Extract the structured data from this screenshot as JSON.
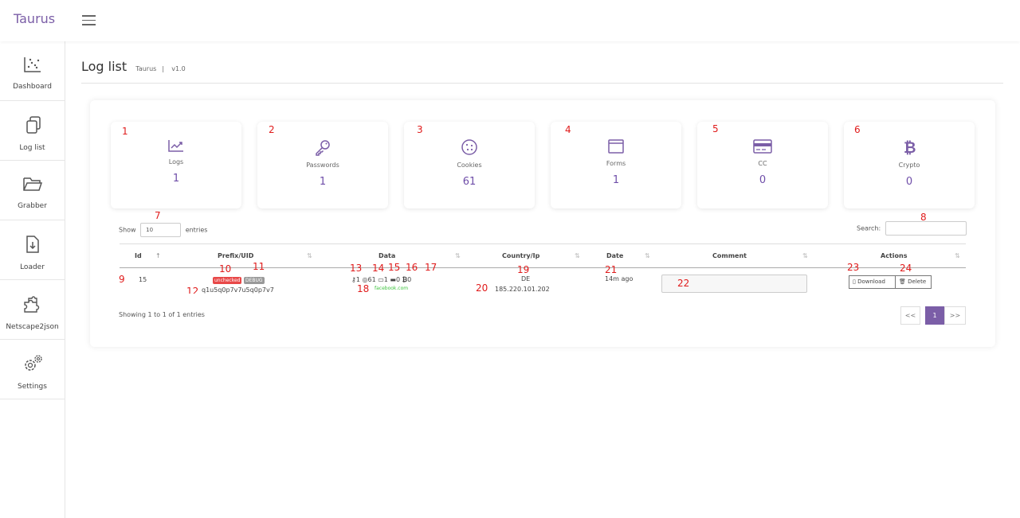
{
  "app": {
    "brand": "Taurus"
  },
  "sidebar": {
    "items": [
      {
        "label": "Dashboard",
        "icon": "dashboard-chart-icon"
      },
      {
        "label": "Log list",
        "icon": "documents-icon"
      },
      {
        "label": "Grabber",
        "icon": "folder-icon"
      },
      {
        "label": "Loader",
        "icon": "file-download-icon"
      },
      {
        "label": "Netscape2json",
        "icon": "puzzle-icon"
      },
      {
        "label": "Settings",
        "icon": "gears-icon"
      }
    ]
  },
  "page": {
    "title": "Log list",
    "subtitle": "Taurus",
    "separator": "|",
    "version": "v1.0"
  },
  "stats": [
    {
      "label": "Logs",
      "value": "1",
      "marker": "1",
      "icon": "trending-up-icon"
    },
    {
      "label": "Passwords",
      "value": "1",
      "marker": "2",
      "icon": "key-icon"
    },
    {
      "label": "Cookies",
      "value": "61",
      "marker": "3",
      "icon": "cookie-icon"
    },
    {
      "label": "Forms",
      "value": "1",
      "marker": "4",
      "icon": "form-window-icon"
    },
    {
      "label": "CC",
      "value": "0",
      "marker": "5",
      "icon": "credit-card-icon"
    },
    {
      "label": "Crypto",
      "value": "0",
      "marker": "6",
      "icon": "bitcoin-icon"
    }
  ],
  "table_controls": {
    "show_label": "Show",
    "entries_value": "10",
    "entries_label": "entries",
    "search_label": "Search:",
    "search_value": ""
  },
  "columns": [
    "Id",
    "Prefix/UID",
    "Data",
    "Country/Ip",
    "Date",
    "Comment",
    "Actions"
  ],
  "row": {
    "id": "15",
    "badge_status": "unchecked",
    "badge_build": "DEBUG",
    "uid": "q1u5q0p7v7u5q0p7v7",
    "passwords": "1",
    "cookies": "61",
    "forms": "1",
    "cc": "0",
    "crypto": "0",
    "domain": "facebook.com",
    "country": "DE",
    "ip": "185.220.101.202",
    "date": "14m ago",
    "comment": "",
    "download_label": "Download",
    "delete_label": "Delete"
  },
  "footer": {
    "info": "Showing 1 to 1 of 1 entries",
    "prev": "<<",
    "page": "1",
    "next": ">>"
  },
  "markers": [
    "7",
    "8",
    "9",
    "10",
    "11",
    "12",
    "13",
    "14",
    "15",
    "16",
    "17",
    "18",
    "19",
    "20",
    "21",
    "22",
    "23",
    "24"
  ],
  "colors": {
    "accent": "#7b5ea7",
    "marker": "#e01b1b",
    "badge_unchecked": "#e84848",
    "badge_debug": "#999999",
    "domain": "#3ec43e"
  }
}
